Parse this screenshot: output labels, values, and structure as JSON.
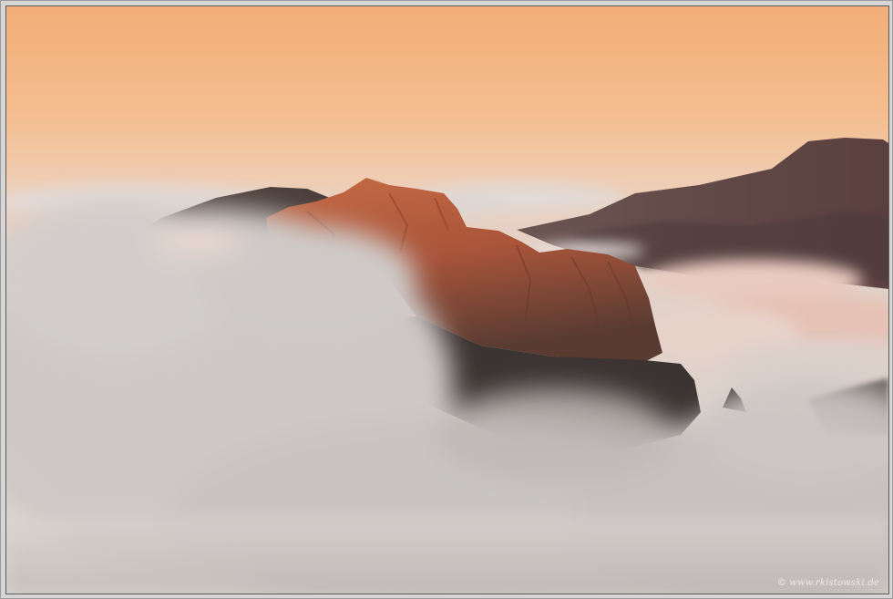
{
  "photo": {
    "subject": "mountain-peak-above-sea-of-clouds",
    "colors": {
      "sky_top": "#f2b07a",
      "sky_mid": "#f4c39a",
      "sky_horizon": "#e9d2c4",
      "rock_lit": "#b8583a",
      "rock_shadow": "#4a3a36",
      "ridge_far": "#5e4645",
      "cloud_light": "#dcd8d6",
      "cloud_pink": "#e8c4b8"
    }
  },
  "watermark": {
    "text": "© www.rkistowski.de"
  }
}
